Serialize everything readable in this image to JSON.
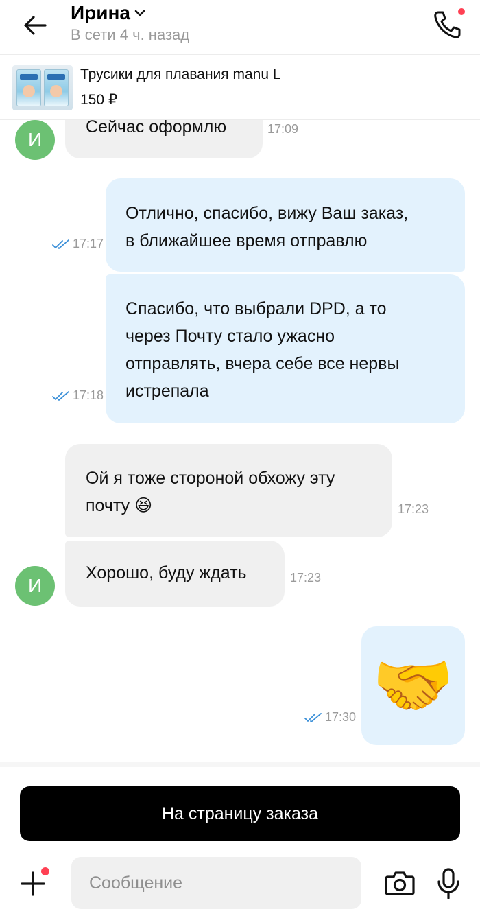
{
  "header": {
    "contact_name": "Ирина",
    "status": "В сети 4 ч. назад"
  },
  "product": {
    "title": "Трусики для плавания manu L",
    "price": "150 ₽"
  },
  "messages": [
    {
      "direction": "incoming",
      "text": "Сейчас оформлю",
      "time": "17:09",
      "avatar_letter": "И"
    },
    {
      "direction": "outgoing",
      "text_lines": [
        "Отлично, спасибо, вижу Ваш заказ,",
        "в ближайшее время отправлю"
      ],
      "time": "17:17",
      "read": true
    },
    {
      "direction": "outgoing",
      "text_lines": [
        "Спасибо, что выбрали DPD, а то",
        "через Почту стало ужасно",
        "отправлять, вчера себе все нервы",
        "истрепала"
      ],
      "time": "17:18",
      "read": true
    },
    {
      "direction": "incoming",
      "text_lines": [
        "Ой я тоже стороной обхожу эту",
        "почту 😆"
      ],
      "time": "17:23"
    },
    {
      "direction": "incoming",
      "text": "Хорошо, буду ждать",
      "time": "17:23",
      "avatar_letter": "И"
    },
    {
      "direction": "outgoing",
      "text": "🤝",
      "time": "17:30",
      "read": true
    }
  ],
  "order_button": {
    "label": "На страницу заказа"
  },
  "composer": {
    "placeholder": "Сообщение"
  },
  "colors": {
    "avatar": "#6cc173",
    "incoming_bubble": "#f0f0f0",
    "outgoing_bubble": "#e3f2fd",
    "read_ticks": "#3a8fd8",
    "notification_dot": "#ff4053"
  },
  "icons": {
    "back": "arrow-left-icon",
    "name_dropdown": "chevron-down-icon",
    "call": "phone-icon",
    "attach": "plus-icon",
    "camera": "camera-icon",
    "mic": "microphone-icon",
    "read": "double-check-icon"
  }
}
